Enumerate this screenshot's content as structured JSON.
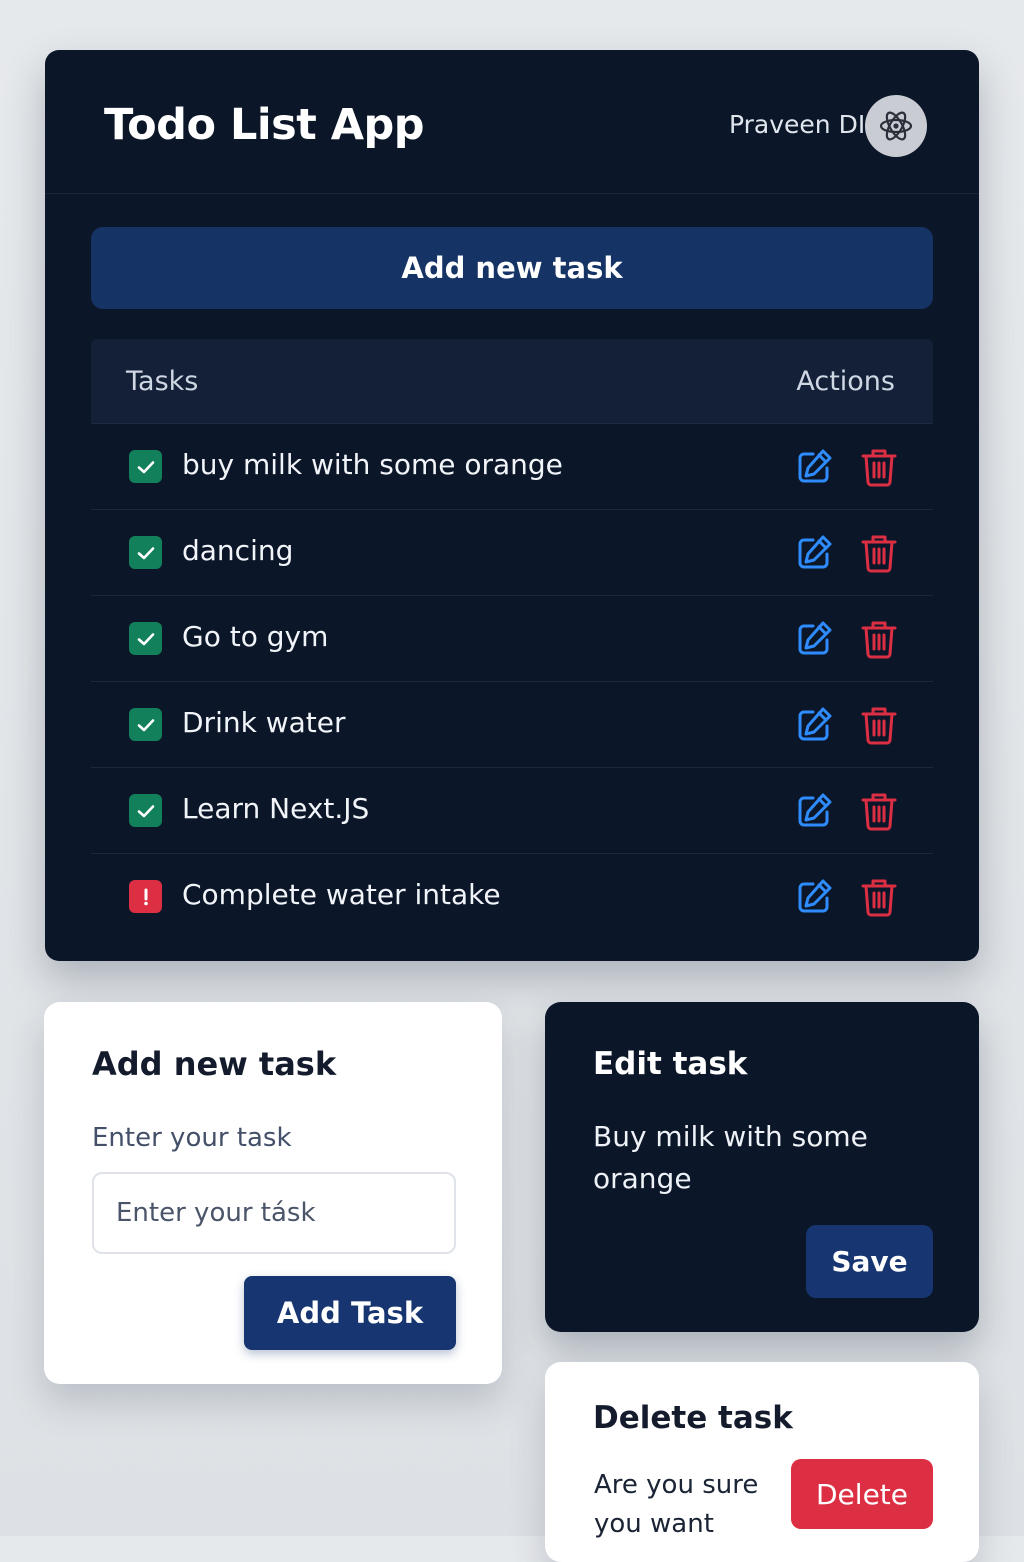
{
  "header": {
    "title": "Todo List App",
    "user_name": "Praveen DI",
    "avatar_icon": "atom-icon"
  },
  "toolbar": {
    "add_new_task_label": "Add new task"
  },
  "table": {
    "columns": {
      "tasks": "Tasks",
      "actions": "Actions"
    },
    "rows": [
      {
        "text": "buy milk with some orange",
        "status": "done"
      },
      {
        "text": "dancing",
        "status": "done"
      },
      {
        "text": "Go to gym",
        "status": "done"
      },
      {
        "text": "Drink water",
        "status": "done"
      },
      {
        "text": "Learn Next.JS",
        "status": "done"
      },
      {
        "text": "Complete water intake",
        "status": "alert"
      }
    ]
  },
  "add_panel": {
    "title": "Add new task",
    "label": "Enter your task",
    "placeholder": "Enter your tásk",
    "button": "Add Task"
  },
  "edit_panel": {
    "title": "Edit task",
    "task_text": "Buy milk with some orange",
    "save_button": "Save"
  },
  "delete_panel": {
    "title": "Delete task",
    "message": "Are you sure you want",
    "delete_button": "Delete"
  },
  "colors": {
    "background": "#e2e6e9",
    "card_dark": "#0b1628",
    "primary": "#163366",
    "edit_blue": "#2f8cff",
    "delete_red": "#dc2f43",
    "done_green": "#12805a"
  }
}
